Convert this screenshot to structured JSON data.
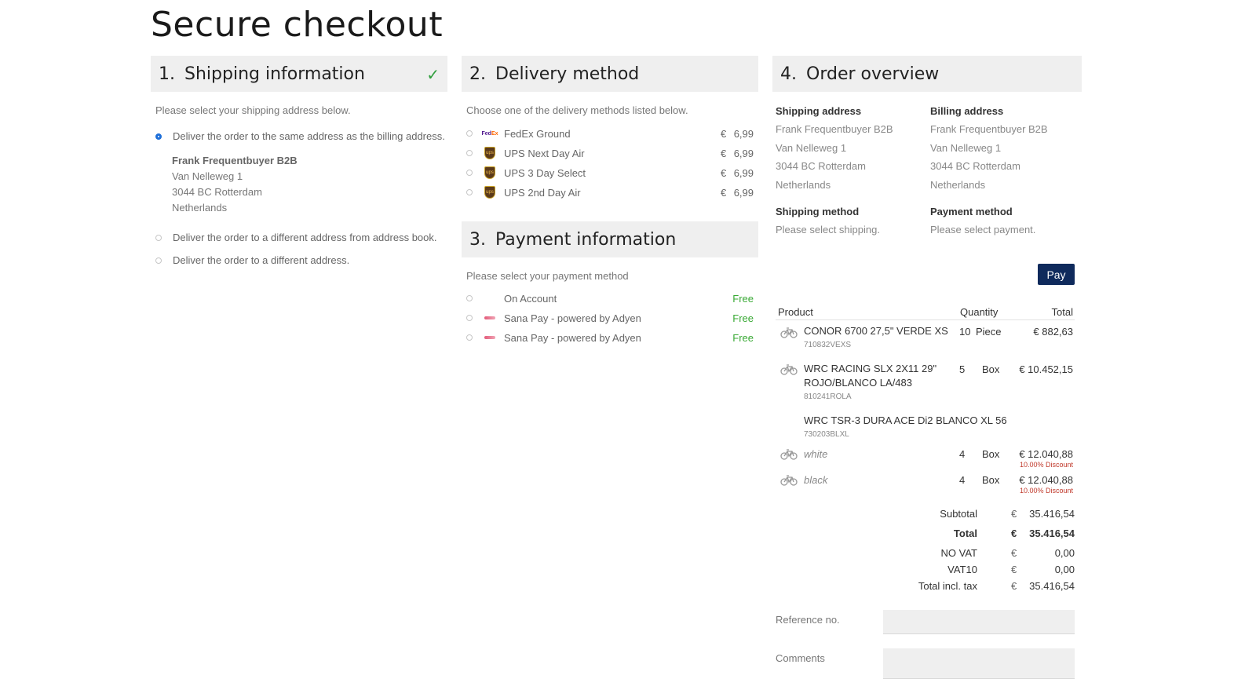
{
  "page_title": "Secure checkout",
  "shipping": {
    "num": "1.",
    "title": "Shipping information",
    "hint": "Please select your shipping address below.",
    "options": [
      "Deliver the order to the same address as the billing address.",
      "Deliver the order to a different address from address book.",
      "Deliver the order to a different address."
    ],
    "address": {
      "name": "Frank Frequentbuyer B2B",
      "street": "Van Nelleweg 1",
      "city": "3044 BC Rotterdam",
      "country": "Netherlands"
    }
  },
  "delivery": {
    "num": "2.",
    "title": "Delivery method",
    "hint": "Choose one of the delivery methods listed below.",
    "methods": [
      {
        "icon": "fedex-logo-icon",
        "label": "FedEx Ground",
        "currency": "€",
        "price": "6,99"
      },
      {
        "icon": "ups-logo-icon",
        "label": "UPS Next Day Air",
        "currency": "€",
        "price": "6,99"
      },
      {
        "icon": "ups-logo-icon",
        "label": "UPS 3 Day Select",
        "currency": "€",
        "price": "6,99"
      },
      {
        "icon": "ups-logo-icon",
        "label": "UPS 2nd Day Air",
        "currency": "€",
        "price": "6,99"
      }
    ]
  },
  "payment": {
    "num": "3.",
    "title": "Payment information",
    "hint": "Please select your payment method",
    "methods": [
      {
        "label": "On Account",
        "price": "Free"
      },
      {
        "icon": "sana-pay-logo-icon",
        "label": "Sana Pay - powered by Adyen",
        "price": "Free"
      },
      {
        "icon": "sana-pay-logo-icon",
        "label": "Sana Pay - powered by Adyen",
        "price": "Free"
      }
    ]
  },
  "overview": {
    "num": "4.",
    "title": "Order overview",
    "shipping_address_label": "Shipping address",
    "billing_address_label": "Billing address",
    "shipping_address": [
      "Frank Frequentbuyer B2B",
      "Van Nelleweg 1",
      "3044 BC Rotterdam",
      "Netherlands"
    ],
    "billing_address": [
      "Frank Frequentbuyer B2B",
      "Van Nelleweg 1",
      "3044 BC Rotterdam",
      "Netherlands"
    ],
    "shipping_method_label": "Shipping method",
    "shipping_method_value": "Please select shipping.",
    "payment_method_label": "Payment method",
    "payment_method_value": "Please select payment.",
    "pay_label": "Pay",
    "columns": {
      "product": "Product",
      "quantity": "Quantity",
      "total": "Total"
    },
    "lines": [
      {
        "name": "CONOR 6700 27,5\" VERDE XS",
        "code": "710832VEXS",
        "qty": "10",
        "unit": "Piece",
        "total": "€ 882,63"
      },
      {
        "name_1": "WRC RACING SLX 2X11 29\"",
        "name_2": "ROJO/BLANCO LA/483",
        "code": "810241ROLA",
        "qty": "5",
        "unit": "Box",
        "total": "€ 10.452,15"
      },
      {
        "name": "WRC TSR-3 DURA ACE Di2 BLANCO XL 56",
        "code": "730203BLXL",
        "variants": [
          {
            "name": "white",
            "qty": "4",
            "unit": "Box",
            "total": "€ 12.040,88",
            "discount": "10.00% Discount"
          },
          {
            "name": "black",
            "qty": "4",
            "unit": "Box",
            "total": "€ 12.040,88",
            "discount": "10.00% Discount"
          }
        ]
      }
    ],
    "totals": {
      "subtotal_label": "Subtotal",
      "subtotal_cur": "€",
      "subtotal": "35.416,54",
      "total_label": "Total",
      "total_cur": "€",
      "total": "35.416,54",
      "novat_label": "NO VAT",
      "novat_cur": "€",
      "novat": "0,00",
      "vat10_label": "VAT10",
      "vat10_cur": "€",
      "vat10": "0,00",
      "incl_label": "Total incl. tax",
      "incl_cur": "€",
      "incl": "35.416,54"
    },
    "reference_label": "Reference no.",
    "comments_label": "Comments"
  },
  "colors": {
    "accent": "#0f2a5c",
    "free": "#39a935",
    "check": "#2e9e3c",
    "discount": "#c0392b",
    "radio_selected": "#1e6fd9"
  }
}
